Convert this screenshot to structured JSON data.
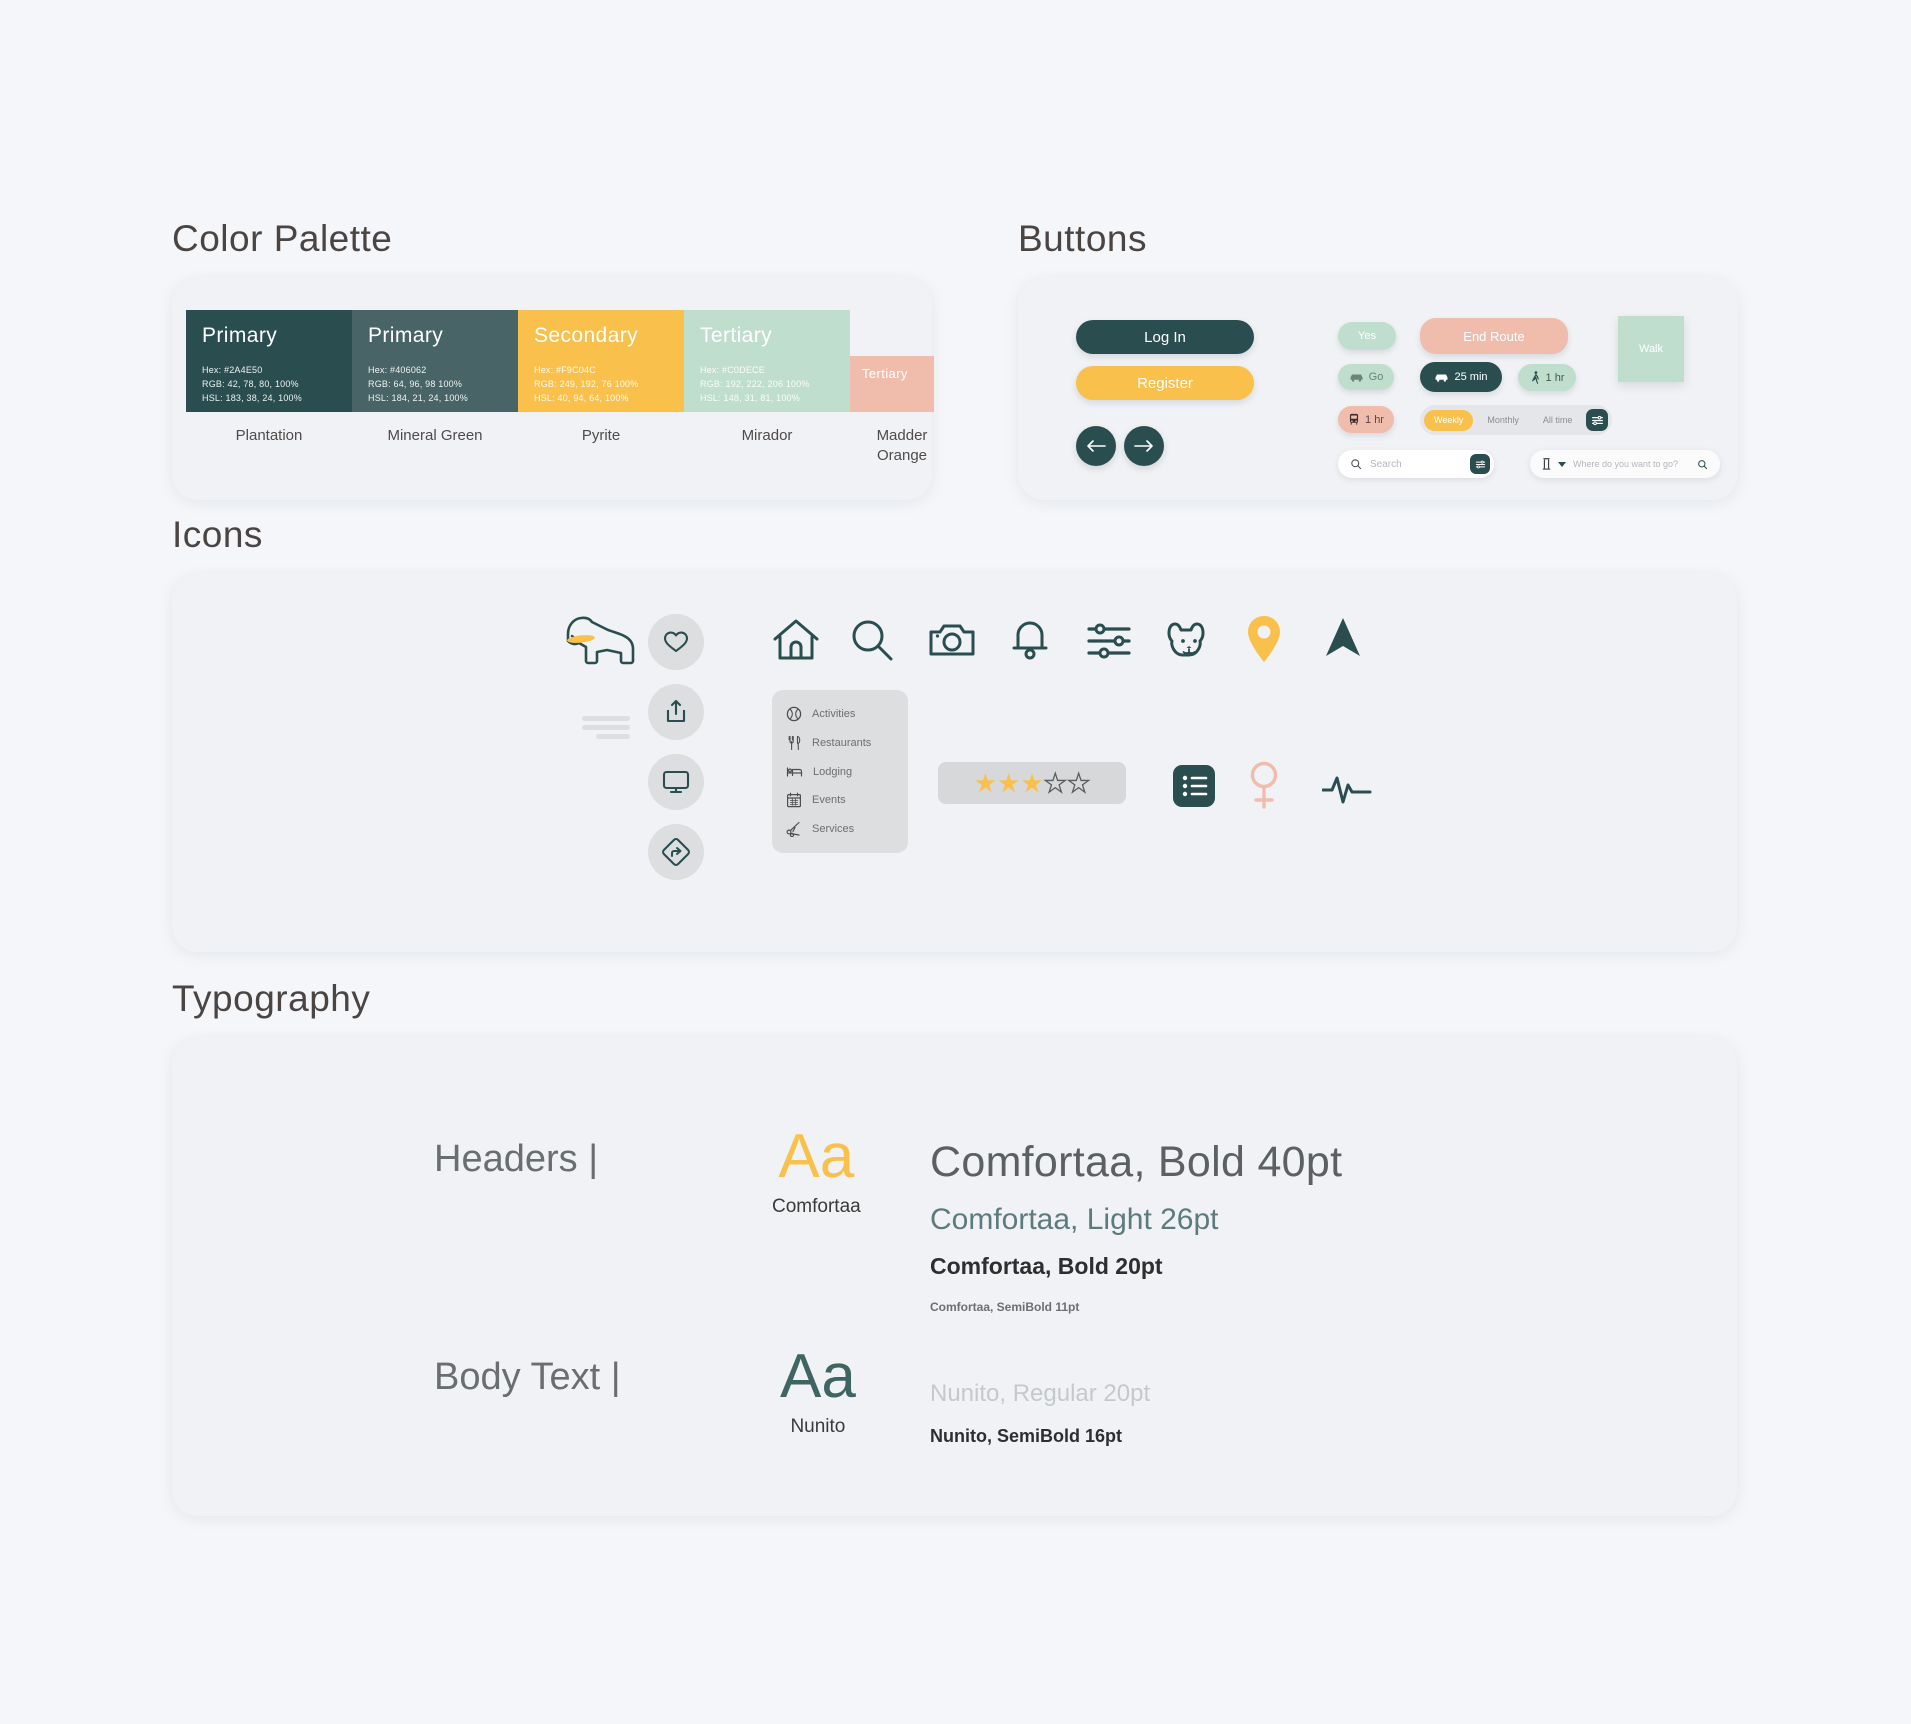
{
  "sections": {
    "color_palette": "Color Palette",
    "buttons": "Buttons",
    "icons": "Icons",
    "typography": "Typography"
  },
  "palette": {
    "swatches": [
      {
        "role": "Primary",
        "name": "Plantation",
        "hex_label": "Hex: #2A4E50",
        "rgb_label": "RGB: 42, 78, 80, 100%",
        "hsl_label": "HSL: 183, 38, 24, 100%",
        "hex": "#2A4E50"
      },
      {
        "role": "Primary",
        "name": "Mineral Green",
        "hex_label": "Hex: #406062",
        "rgb_label": "RGB: 64, 96, 98 100%",
        "hsl_label": "HSL: 184, 21, 24, 100%",
        "hex": "#406062"
      },
      {
        "role": "Secondary",
        "name": "Pyrite",
        "hex_label": "Hex: #F9C04C",
        "rgb_label": "RGB: 249, 192, 76 100%",
        "hsl_label": "HSL: 40, 94, 64, 100%",
        "hex": "#F9C04C"
      },
      {
        "role": "Tertiary",
        "name": "Mirador",
        "hex_label": "Hex: #C0DECE",
        "rgb_label": "RGB: 192, 222, 206 100%",
        "hsl_label": "HSL: 148, 31, 81, 100%",
        "hex": "#C0DECE"
      },
      {
        "role": "Tertiary",
        "name": "Madder Orange",
        "hex_label": "",
        "rgb_label": "",
        "hsl_label": "",
        "hex": "#F0BCAC"
      }
    ]
  },
  "buttons": {
    "login": "Log In",
    "register": "Register",
    "yes": "Yes",
    "end_route": "End Route",
    "go": "Go",
    "time_drive": "25 min",
    "time_walk": "1 hr",
    "time_bus": "1 hr",
    "walk_tile": "Walk",
    "segmented": [
      {
        "label": "Weekly",
        "active": true
      },
      {
        "label": "Monthly",
        "active": false
      },
      {
        "label": "All time",
        "active": false
      }
    ],
    "search_placeholder": "Search",
    "destination_placeholder": "Where do you want to go?"
  },
  "icons": {
    "menu_items": [
      {
        "label": "Activities",
        "icon": "baseball-icon"
      },
      {
        "label": "Restaurants",
        "icon": "utensils-icon"
      },
      {
        "label": "Lodging",
        "icon": "bed-icon"
      },
      {
        "label": "Events",
        "icon": "calendar-icon"
      },
      {
        "label": "Services",
        "icon": "scissors-icon"
      }
    ],
    "rating": {
      "filled": 3,
      "total": 5
    }
  },
  "typography": {
    "rows": [
      {
        "label": "Headers |",
        "glyph": "Aa",
        "family": "Comfortaa",
        "glyph_color": "#F9C04C"
      },
      {
        "label": "Body Text |",
        "glyph": "Aa",
        "family": "Nunito",
        "glyph_color": "#3F6562"
      }
    ],
    "specimens": {
      "header_bold_40": "Comfortaa, Bold 40pt",
      "header_light_26": "Comfortaa, Light 26pt",
      "header_bold_20": "Comfortaa, Bold 20pt",
      "header_semibold_11": "Comfortaa, SemiBold 11pt",
      "body_regular_20": "Nunito, Regular 20pt",
      "body_semibold_16": "Nunito, SemiBold 16pt"
    }
  }
}
